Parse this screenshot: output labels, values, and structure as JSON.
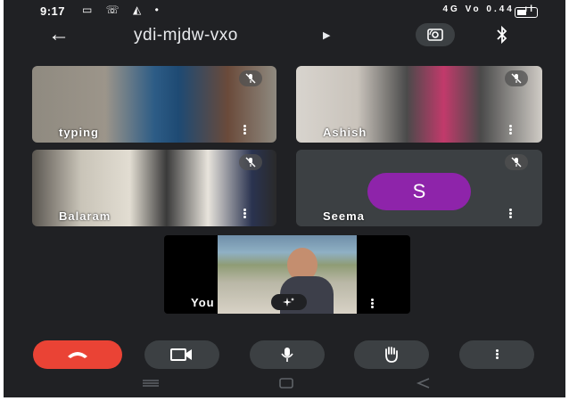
{
  "status_bar": {
    "time": "9:17",
    "network_left": "4G",
    "network_right": "Vo",
    "speed": "0.44",
    "battery_label": "30"
  },
  "top_bar": {
    "meeting_code": "ydi-mjdw-vxo"
  },
  "participants": [
    {
      "name": "typing",
      "muted": true
    },
    {
      "name": "Ashish",
      "muted": true
    },
    {
      "name": "Balaram",
      "muted": true
    },
    {
      "name": "Seema",
      "muted": true,
      "avatar_letter": "S",
      "avatar_color": "#8e24aa"
    },
    {
      "name": "You",
      "self": true
    }
  ],
  "controls": [
    "end-call",
    "camera",
    "microphone",
    "raise-hand",
    "more-options"
  ],
  "colors": {
    "background": "#202124",
    "tile": "#3c4043",
    "end_call": "#ea4335"
  }
}
